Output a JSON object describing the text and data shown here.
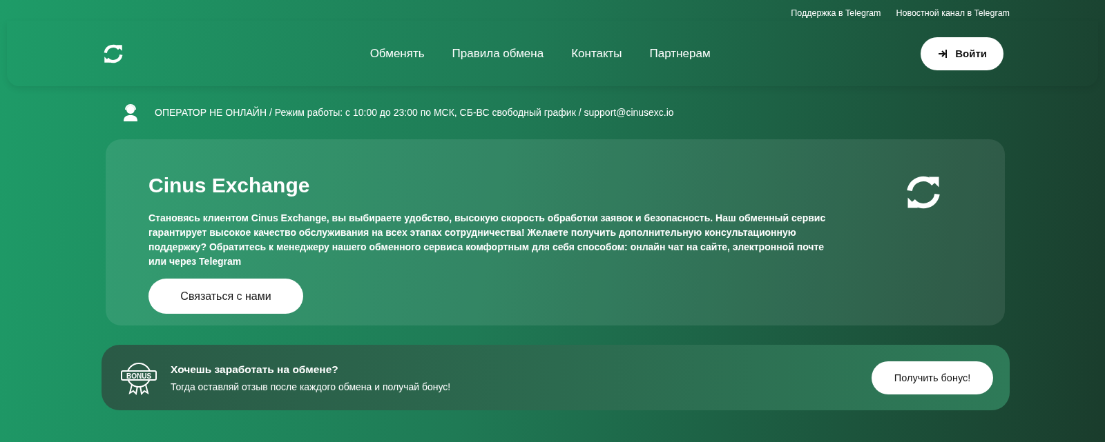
{
  "top_links": [
    "Поддержка в Telegram",
    "Новостной канал в Telegram"
  ],
  "nav": {
    "items": [
      "Обменять",
      "Правила обмена",
      "Контакты",
      "Партнерам"
    ],
    "login": "Войти"
  },
  "operator": {
    "online": false,
    "text": "ОПЕРАТОР НЕ ОНЛАЙН / Режим работы: с 10:00 до 23:00 по МСК, СБ-ВС свободный график / support@cinusexc.io"
  },
  "hero": {
    "title": "Cinus Exchange",
    "text": "Становясь клиентом Cinus Exchange, вы выбираете удобство, высокую скорость обработки заявок и безопасность. Наш обменный сервис гарантирует высокое качество обслуживания на всех этапах сотрудничества! Желаете получить дополнительную консультационную поддержку? Обратитесь к менеджеру нашего обменного сервиса комфортным для себя способом: онлайн чат на сайте, электронной почте или через Telegram",
    "button": "Связаться с нами"
  },
  "bonus": {
    "badge": "BONUS",
    "title": "Хочешь заработать на обмене?",
    "text": "Тогда оставляй отзыв после каждого обмена и получай бонус!",
    "button": "Получить бонус!"
  }
}
